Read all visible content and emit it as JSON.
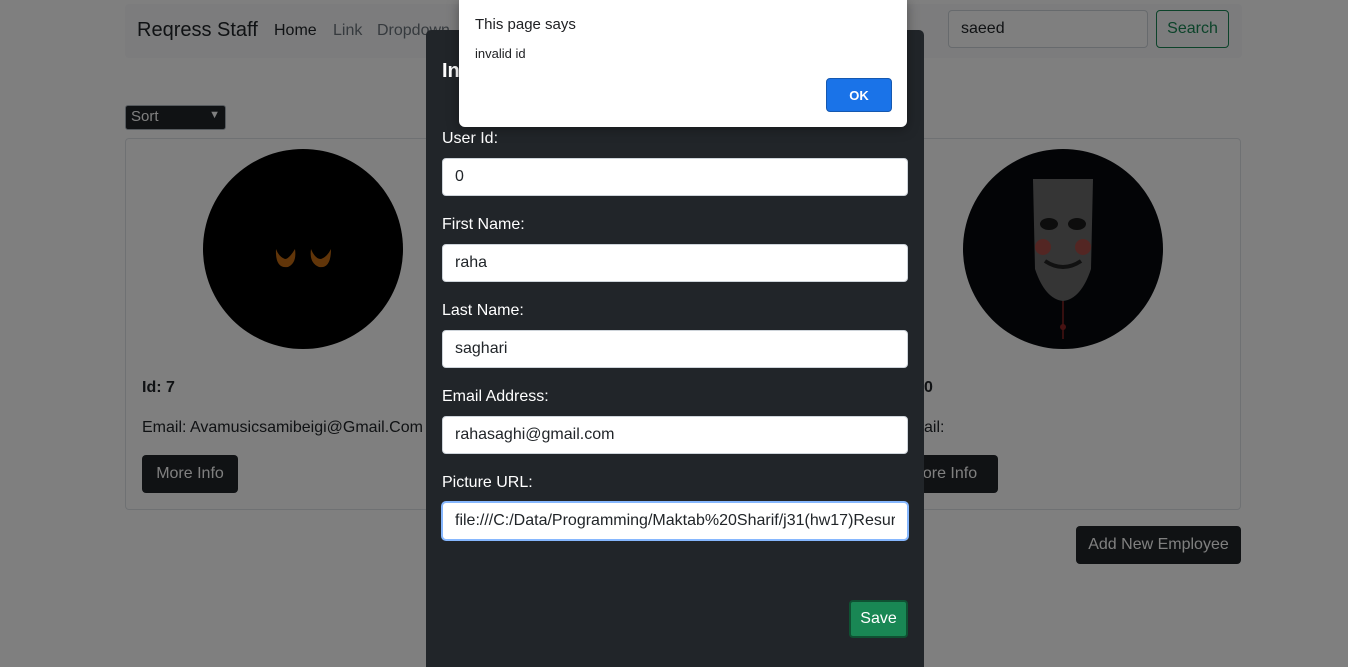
{
  "navbar": {
    "brand": "Reqress Staff",
    "links": [
      "Home",
      "Link",
      "Dropdown"
    ],
    "search_value": "saeed",
    "search_button": "Search"
  },
  "sort": {
    "selected": "Sort"
  },
  "cards": [
    {
      "id_label": "Id: 7",
      "email_label": "Email: Avamusicsamibeigi@Gmail.Com",
      "button": "More Info"
    },
    {
      "id_label": "0",
      "email_label": "ail:",
      "button": "ore Info"
    }
  ],
  "add_button": "Add New Employee",
  "modal": {
    "title": "In",
    "fields": [
      {
        "label": "User Id:",
        "value": "0"
      },
      {
        "label": "First Name:",
        "value": "raha"
      },
      {
        "label": "Last Name:",
        "value": "saghari"
      },
      {
        "label": "Email Address:",
        "value": "rahasaghi@gmail.com"
      },
      {
        "label": "Picture URL:",
        "value": "file:///C:/Data/Programming/Maktab%20Sharif/j31(hw17)Resur"
      }
    ],
    "save_button": "Save"
  },
  "alert": {
    "title": "This page says",
    "message": "invalid id",
    "ok_button": "OK"
  },
  "colors": {
    "accent_green": "#198754",
    "dark": "#212529",
    "alert_blue": "#1a73e8"
  }
}
